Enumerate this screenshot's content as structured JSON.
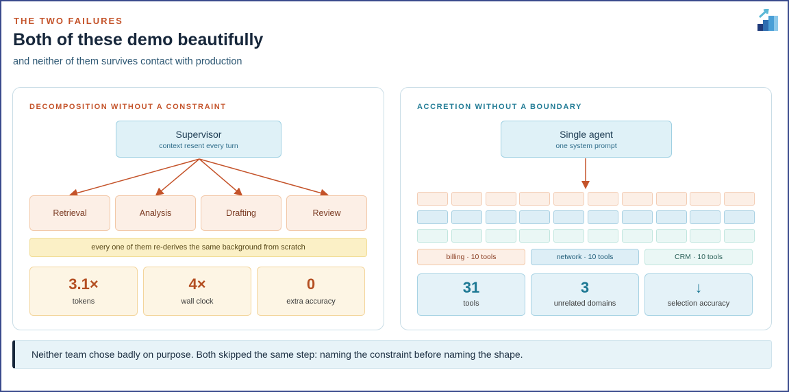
{
  "header": {
    "eyebrow": "THE TWO FAILURES",
    "title": "Both of these demo beautifully",
    "subtitle": "and neither of them survives contact with production"
  },
  "left_panel": {
    "heading": "DECOMPOSITION WITHOUT A CONSTRAINT",
    "root": {
      "title": "Supervisor",
      "subtitle": "context resent every turn"
    },
    "workers": [
      "Retrieval",
      "Analysis",
      "Drafting",
      "Review"
    ],
    "banner": "every one of them re-derives the same background from scratch",
    "stats": [
      {
        "value": "3.1×",
        "label": "tokens"
      },
      {
        "value": "4×",
        "label": "wall clock"
      },
      {
        "value": "0",
        "label": "extra accuracy"
      }
    ]
  },
  "right_panel": {
    "heading": "ACCRETION WITHOUT A BOUNDARY",
    "root": {
      "title": "Single agent",
      "subtitle": "one system prompt"
    },
    "domains": [
      "billing · 10 tools",
      "network · 10 tools",
      "CRM · 10 tools"
    ],
    "stats": [
      {
        "value": "31",
        "label": "tools"
      },
      {
        "value": "3",
        "label": "unrelated domains"
      },
      {
        "value": "↓",
        "label": "selection accuracy"
      }
    ]
  },
  "footer": {
    "text": "Neither team chose badly on purpose. Both skipped the same step: naming the constraint before naming the shape."
  },
  "colors": {
    "warm_accent": "#c4532a",
    "cool_accent": "#1f7a94",
    "title": "#16263a"
  }
}
